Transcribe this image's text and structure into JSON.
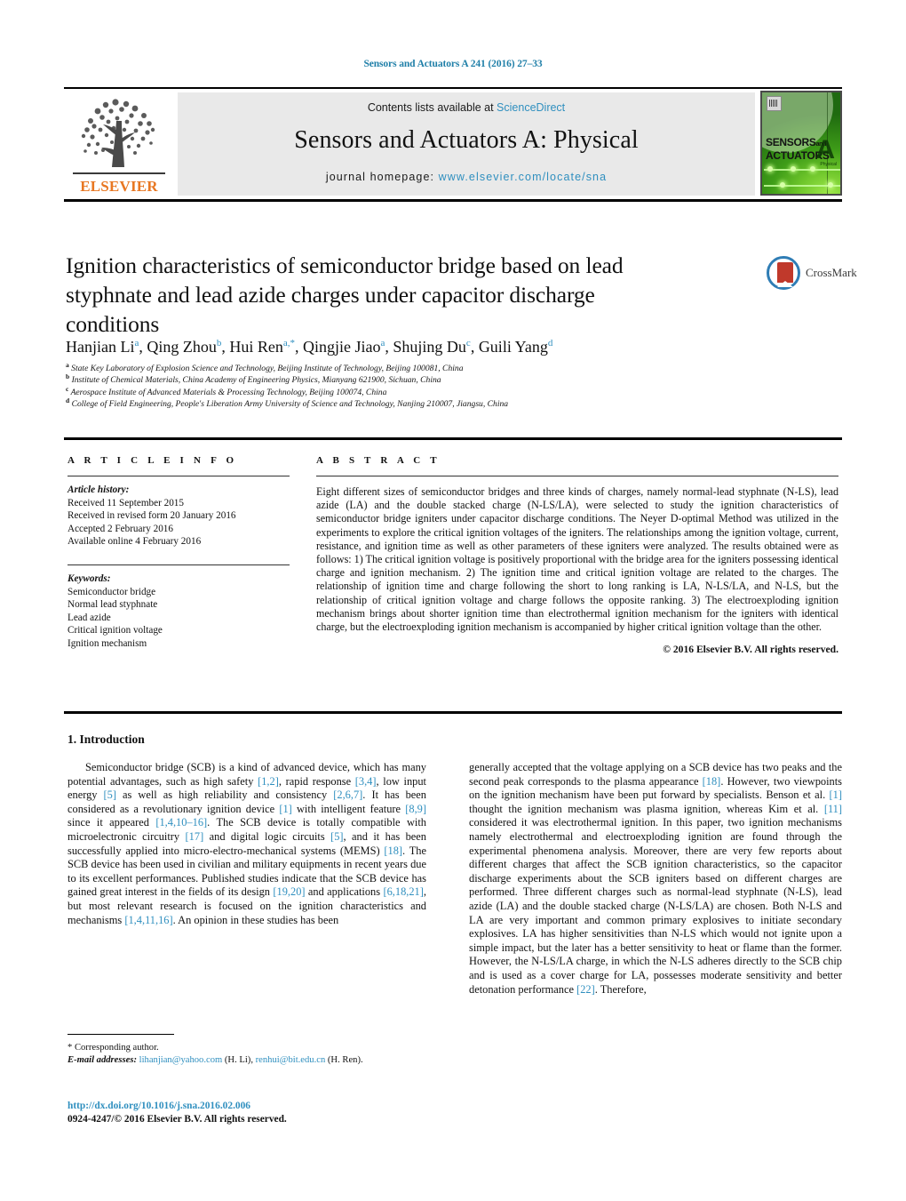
{
  "running_head": "Sensors and Actuators A 241 (2016) 27–33",
  "masthead": {
    "contents_prefix": "Contents lists available at ",
    "sciencedirect": "ScienceDirect",
    "journal_title": "Sensors and Actuators A: Physical",
    "homepage_label": "journal homepage: ",
    "homepage_url": "www.elsevier.com/locate/sna",
    "publisher_logo_text": "ELSEVIER",
    "cover": {
      "line1": "SENSORS",
      "and": "and",
      "line2": "ACTUATORS",
      "letter": "A",
      "sub": "Physical"
    }
  },
  "article": {
    "title": "Ignition characteristics of semiconductor bridge based on lead styphnate and lead azide charges under capacitor discharge conditions",
    "crossmark_label": "CrossMark",
    "authors": [
      {
        "name": "Hanjian Li",
        "marks": "a"
      },
      {
        "name": "Qing Zhou",
        "marks": "b"
      },
      {
        "name": "Hui Ren",
        "marks": "a,*"
      },
      {
        "name": "Qingjie Jiao",
        "marks": "a"
      },
      {
        "name": "Shujing Du",
        "marks": "c"
      },
      {
        "name": "Guili Yang",
        "marks": "d"
      }
    ],
    "affiliations": [
      {
        "mark": "a",
        "text": "State Key Laboratory of Explosion Science and Technology, Beijing Institute of Technology, Beijing 100081, China"
      },
      {
        "mark": "b",
        "text": "Institute of Chemical Materials, China Academy of Engineering Physics, Mianyang 621900, Sichuan, China"
      },
      {
        "mark": "c",
        "text": "Aerospace Institute of Advanced Materials & Processing Technology, Beijing 100074, China"
      },
      {
        "mark": "d",
        "text": "College of Field Engineering, People's Liberation Army University of Science and Technology, Nanjing 210007, Jiangsu, China"
      }
    ]
  },
  "article_info": {
    "heading": "A R T I C L E   I N F O",
    "history_label": "Article history:",
    "history": [
      "Received 11 September 2015",
      "Received in revised form 20 January 2016",
      "Accepted 2 February 2016",
      "Available online 4 February 2016"
    ],
    "keywords_label": "Keywords:",
    "keywords": [
      "Semiconductor bridge",
      "Normal lead styphnate",
      "Lead azide",
      "Critical ignition voltage",
      "Ignition mechanism"
    ]
  },
  "abstract": {
    "heading": "A B S T R A C T",
    "text": "Eight different sizes of semiconductor bridges and three kinds of charges, namely normal-lead styphnate (N-LS), lead azide (LA) and the double stacked charge (N-LS/LA), were selected to study the ignition characteristics of semiconductor bridge igniters under capacitor discharge conditions. The Neyer D-optimal Method was utilized in the experiments to explore the critical ignition voltages of the igniters. The relationships among the ignition voltage, current, resistance, and ignition time as well as other parameters of these igniters were analyzed. The results obtained were as follows: 1) The critical ignition voltage is positively proportional with the bridge area for the igniters possessing identical charge and ignition mechanism. 2) The ignition time and critical ignition voltage are related to the charges. The relationship of ignition time and charge following the short to long ranking is LA, N-LS/LA, and N-LS, but the relationship of critical ignition voltage and charge follows the opposite ranking. 3) The electroexploding ignition mechanism brings about shorter ignition time than electrothermal ignition mechanism for the igniters with identical charge, but the electroexploding ignition mechanism is accompanied by higher critical ignition voltage than the other.",
    "copyright": "© 2016 Elsevier B.V. All rights reserved."
  },
  "body": {
    "section_heading": "1.  Introduction",
    "left_paragraph_parts": [
      {
        "t": "Semiconductor bridge (SCB) is a kind of advanced device, which has many potential advantages, such as high safety ",
        "r": false
      },
      {
        "t": "[1,2]",
        "r": true
      },
      {
        "t": ", rapid response ",
        "r": false
      },
      {
        "t": "[3,4]",
        "r": true
      },
      {
        "t": ", low input energy ",
        "r": false
      },
      {
        "t": "[5]",
        "r": true
      },
      {
        "t": " as well as high reliability and consistency ",
        "r": false
      },
      {
        "t": "[2,6,7]",
        "r": true
      },
      {
        "t": ". It has been considered as a revolutionary ignition device ",
        "r": false
      },
      {
        "t": "[1]",
        "r": true
      },
      {
        "t": " with intelligent feature ",
        "r": false
      },
      {
        "t": "[8,9]",
        "r": true
      },
      {
        "t": " since it appeared ",
        "r": false
      },
      {
        "t": "[1,4,10–16]",
        "r": true
      },
      {
        "t": ". The SCB device is totally compatible with microelectronic circuitry ",
        "r": false
      },
      {
        "t": "[17]",
        "r": true
      },
      {
        "t": " and digital logic circuits ",
        "r": false
      },
      {
        "t": "[5]",
        "r": true
      },
      {
        "t": ", and it has been successfully applied into micro-electro-mechanical systems (MEMS) ",
        "r": false
      },
      {
        "t": "[18]",
        "r": true
      },
      {
        "t": ". The SCB device has been used in civilian and military equipments in recent years due to its excellent performances. Published studies indicate that the SCB device has gained great interest in the fields of its design ",
        "r": false
      },
      {
        "t": "[19,20]",
        "r": true
      },
      {
        "t": " and applications ",
        "r": false
      },
      {
        "t": "[6,18,21]",
        "r": true
      },
      {
        "t": ", but most relevant research is focused on the ignition characteristics and mechanisms ",
        "r": false
      },
      {
        "t": "[1,4,11,16]",
        "r": true
      },
      {
        "t": ". An opinion in these studies has been",
        "r": false
      }
    ],
    "right_paragraph_parts": [
      {
        "t": "generally accepted that the voltage applying on a SCB device has two peaks and the second peak corresponds to the plasma appearance ",
        "r": false
      },
      {
        "t": "[18]",
        "r": true
      },
      {
        "t": ". However, two viewpoints on the ignition mechanism have been put forward by specialists. Benson et al. ",
        "r": false
      },
      {
        "t": "[1]",
        "r": true
      },
      {
        "t": " thought the ignition mechanism was plasma ignition, whereas Kim et al. ",
        "r": false
      },
      {
        "t": "[11]",
        "r": true
      },
      {
        "t": " considered it was electrothermal ignition. In this paper, two ignition mechanisms namely electrothermal and electroexploding ignition are found through the experimental phenomena analysis. Moreover, there are very few reports about different charges that affect the SCB ignition characteristics, so the capacitor discharge experiments about the SCB igniters based on different charges are performed. Three different charges such as normal-lead styphnate (N-LS), lead azide (LA) and the double stacked charge (N-LS/LA) are chosen. Both N-LS and LA are very important and common primary explosives to initiate secondary explosives. LA has higher sensitivities than N-LS which would not ignite upon a simple impact, but the later has a better sensitivity to heat or flame than the former. However, the N-LS/LA charge, in which the N-LS adheres directly to the SCB chip and is used as a cover charge for LA, possesses moderate sensitivity and better detonation performance ",
        "r": false
      },
      {
        "t": "[22]",
        "r": true
      },
      {
        "t": ". Therefore,",
        "r": false
      }
    ]
  },
  "footnote": {
    "corresponding": "* Corresponding author.",
    "email_label": "E-mail addresses:",
    "email1": "lihanjian@yahoo.com",
    "email1_who": "(H. Li),",
    "email2": "renhui@bit.edu.cn",
    "email2_who": "(H. Ren)."
  },
  "doi_block": {
    "doi": "http://dx.doi.org/10.1016/j.sna.2016.02.006",
    "issn_line": "0924-4247/© 2016 Elsevier B.V. All rights reserved."
  },
  "colors": {
    "link": "#2f8fbf",
    "elsevier_orange": "#E87722",
    "rule": "#000000"
  }
}
